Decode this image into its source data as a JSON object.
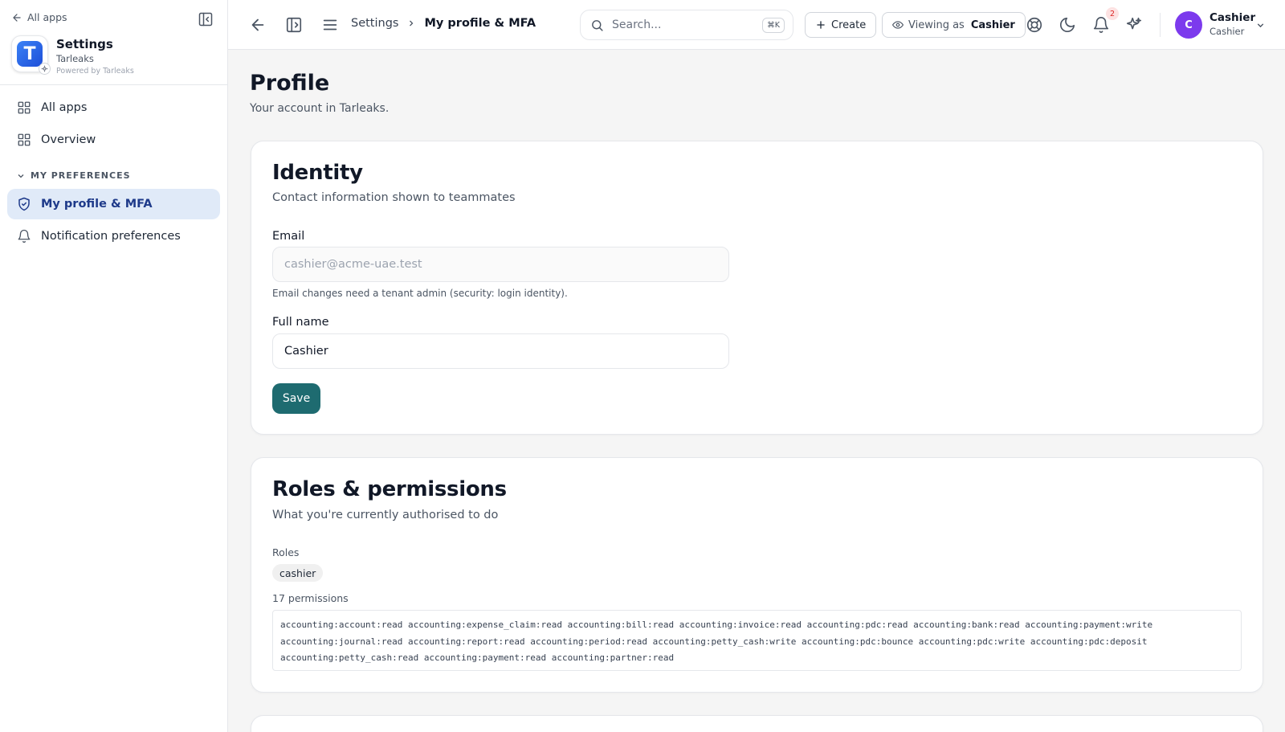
{
  "sidebar": {
    "back_label": "All apps",
    "app": {
      "logo_letter": "T",
      "name": "Settings",
      "org": "Tarleaks",
      "powered": "Powered by Tarleaks"
    },
    "items": [
      {
        "label": "All apps"
      },
      {
        "label": "Overview"
      }
    ],
    "section_label": "MY PREFERENCES",
    "section_items": [
      {
        "label": "My profile & MFA",
        "active": true
      },
      {
        "label": "Notification preferences",
        "active": false
      }
    ]
  },
  "topbar": {
    "breadcrumb": [
      "Settings",
      "My profile & MFA"
    ],
    "search": {
      "placeholder": "Search...",
      "shortcut": "⌘K"
    },
    "create_label": "Create",
    "viewing_label": "Viewing as",
    "viewing_role": "Cashier",
    "notification_count": "2",
    "user": {
      "initial": "C",
      "name": "Cashier",
      "role": "Cashier",
      "avatar_color": "#7c3aed"
    }
  },
  "page": {
    "title": "Profile",
    "subtitle": "Your account in Tarleaks."
  },
  "identity": {
    "title": "Identity",
    "subtitle": "Contact information shown to teammates",
    "email_label": "Email",
    "email_value": "cashier@acme-uae.test",
    "email_hint": "Email changes need a tenant admin (security: login identity).",
    "name_label": "Full name",
    "name_value": "Cashier",
    "save_label": "Save"
  },
  "roles": {
    "title": "Roles & permissions",
    "subtitle": "What you're currently authorised to do",
    "roles_label": "Roles",
    "roles": [
      "cashier"
    ],
    "permissions_label": "17 permissions",
    "permissions": [
      "accounting:account:read",
      "accounting:expense_claim:read",
      "accounting:bill:read",
      "accounting:invoice:read",
      "accounting:pdc:read",
      "accounting:bank:read",
      "accounting:payment:write",
      "accounting:journal:read",
      "accounting:report:read",
      "accounting:period:read",
      "accounting:petty_cash:write",
      "accounting:pdc:bounce",
      "accounting:pdc:write",
      "accounting:pdc:deposit",
      "accounting:petty_cash:read",
      "accounting:payment:read",
      "accounting:partner:read"
    ]
  },
  "colors": {
    "accent": "#1e6b70",
    "active_nav_bg": "#e0eaf8",
    "active_nav_text": "#1e3a8a"
  }
}
